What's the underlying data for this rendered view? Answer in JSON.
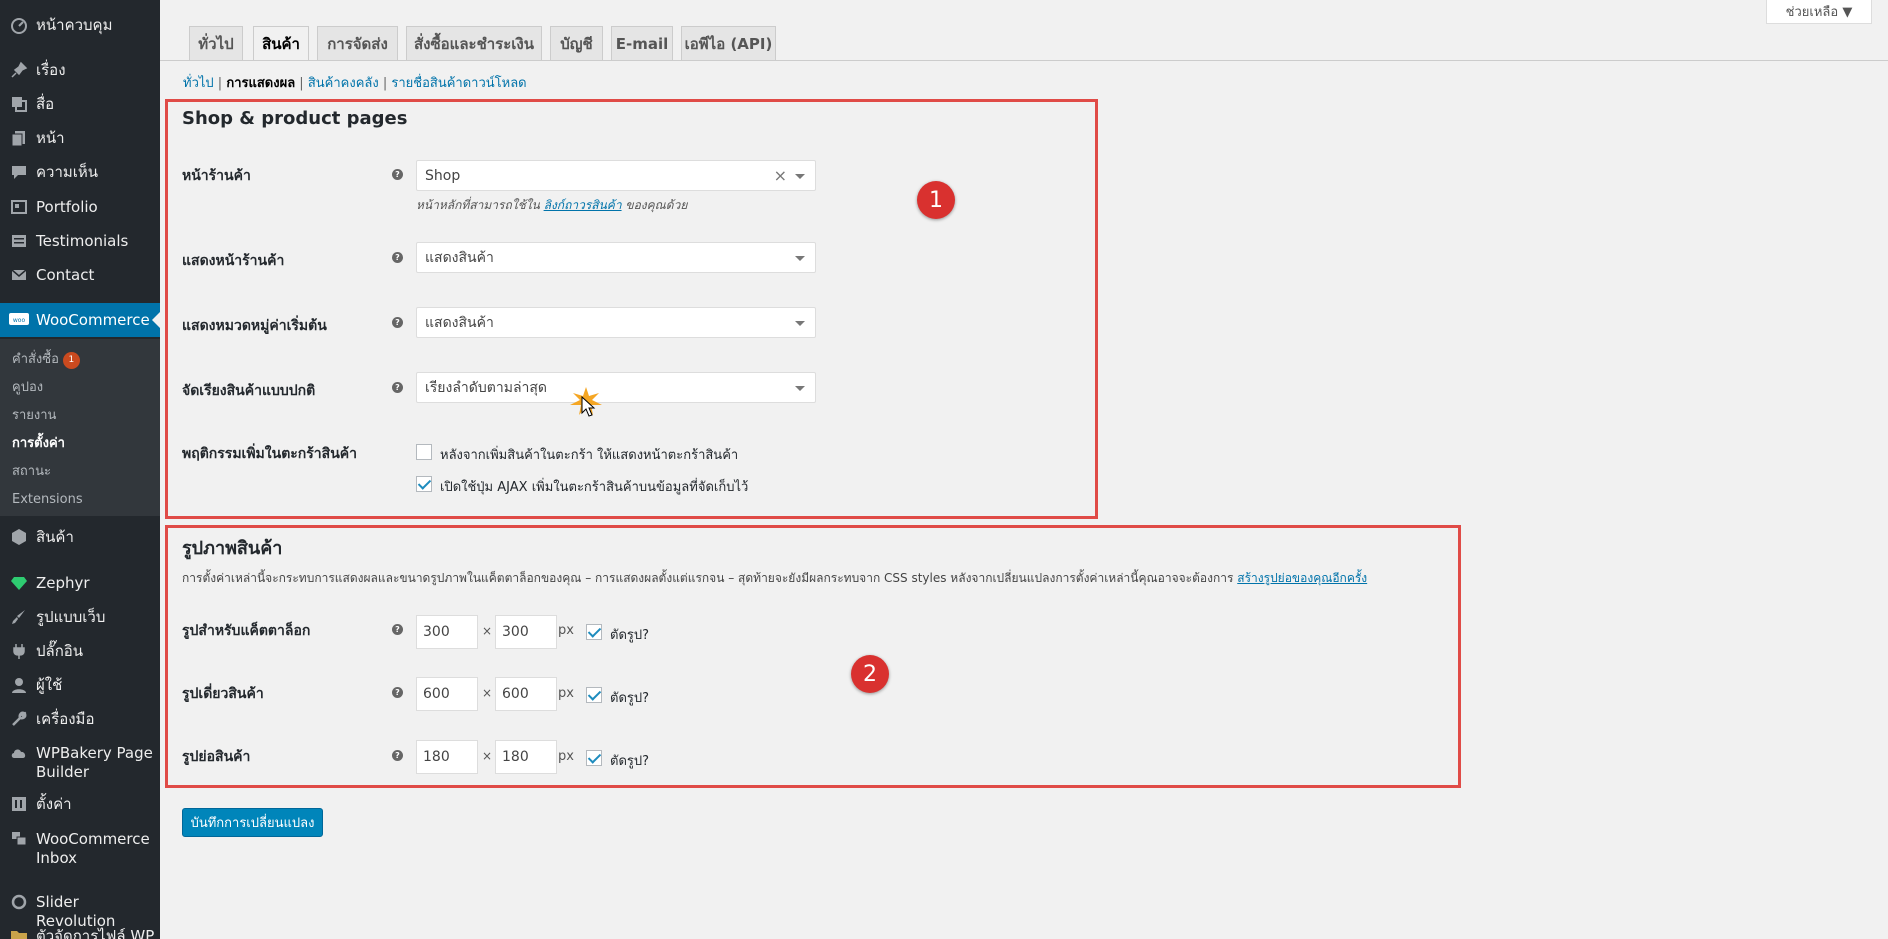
{
  "sidebar": {
    "dashboard": "หน้าควบคุม",
    "posts": "เรื่อง",
    "media": "สื่อ",
    "pages": "หน้า",
    "comments": "ความเห็น",
    "portfolio": "Portfolio",
    "testimonials": "Testimonials",
    "contact": "Contact",
    "woocommerce": "WooCommerce",
    "woo_submenu": {
      "orders": "คำสั่งซื้อ",
      "orders_badge": "1",
      "coupons": "คูปอง",
      "reports": "รายงาน",
      "settings": "การตั้งค่า",
      "status": "สถานะ",
      "extensions": "Extensions"
    },
    "products": "สินค้า",
    "zephyr": "Zephyr",
    "appearance": "รูปแบบเว็บ",
    "plugins": "ปลั๊กอิน",
    "users": "ผู้ใช้",
    "tools": "เครื่องมือ",
    "wpbakery": "WPBakery Page Builder",
    "settings": "ตั้งค่า",
    "woo_inbox": "WooCommerce Inbox",
    "slider_revolution": "Slider Revolution",
    "file_manager": "ตัวจัดการไฟล์ WP"
  },
  "help_button": "ช่วยเหลือ ▼",
  "tabs": {
    "general": "ทั่วไป",
    "products": "สินค้า",
    "shipping": "การจัดส่ง",
    "checkout": "สั่งซื้อและชำระเงิน",
    "accounts": "บัญชี",
    "email": "E-mail",
    "api": "เอพีไอ (API)"
  },
  "subsubsub": {
    "general": "ทั่วไป",
    "display": "การแสดงผล",
    "inventory": "สินค้าคงคลัง",
    "downloadable": "รายชื่อสินค้าดาวน์โหลด",
    "sep": " | "
  },
  "shop_section": {
    "title": "Shop & product pages",
    "shop_page_label": "หน้าร้านค้า",
    "shop_page_value": "Shop",
    "shop_page_desc_pre": "หน้าหลักที่สามารถใช้ใน ",
    "shop_page_desc_link": "ลิงก์ถาวรสินค้า",
    "shop_page_desc_post": " ของคุณด้วย",
    "shop_display_label": "แสดงหน้าร้านค้า",
    "shop_display_value": "แสดงสินค้า",
    "category_display_label": "แสดงหมวดหมู่ค่าเริ่มต้น",
    "category_display_value": "แสดงสินค้า",
    "default_sort_label": "จัดเรียงสินค้าแบบปกติ",
    "default_sort_value": "เรียงลำดับตามล่าสุด",
    "add_to_cart_label": "พฤติกรรมเพิ่มในตะกร้าสินค้า",
    "redirect_cart_text": "หลังจากเพิ่มสินค้าในตะกร้า ให้แสดงหน้าตะกร้าสินค้า",
    "ajax_cart_text": "เปิดใช้ปุ่ม AJAX เพิ่มในตะกร้าสินค้าบนข้อมูลที่จัดเก็บไว้",
    "redirect_cart_checked": false,
    "ajax_cart_checked": true
  },
  "image_section": {
    "title": "รูปภาพสินค้า",
    "desc_pre": "การตั้งค่าเหล่านี้จะกระทบการแสดงผลและขนาดรูปภาพในแค็ตตาล็อกของคุณ – การแสดงผลตั้งแต่แรกจน – สุดท้ายจะยังมีผลกระทบจาก CSS styles หลังจากเปลี่ยนแปลงการตั้งค่าเหล่านี้คุณอาจจะต้องการ ",
    "desc_link": "สร้างรูปย่อของคุณอีกครั้ง",
    "catalog_label": "รูปสำหรับแค็ตตาล็อก",
    "catalog_w": "300",
    "catalog_h": "300",
    "single_label": "รูปเดี่ยวสินค้า",
    "single_w": "600",
    "single_h": "600",
    "thumb_label": "รูปย่อสินค้า",
    "thumb_w": "180",
    "thumb_h": "180",
    "times": "×",
    "px": "px",
    "crop_label": "ตัดรูป?"
  },
  "annotations": {
    "one": "1",
    "two": "2"
  },
  "save_button": "บันทึกการเปลี่ยนแปลง",
  "colors": {
    "sidebar": "#23282d",
    "active": "#0073aa",
    "highlight": "#e04b47",
    "button": "#0085ba"
  }
}
